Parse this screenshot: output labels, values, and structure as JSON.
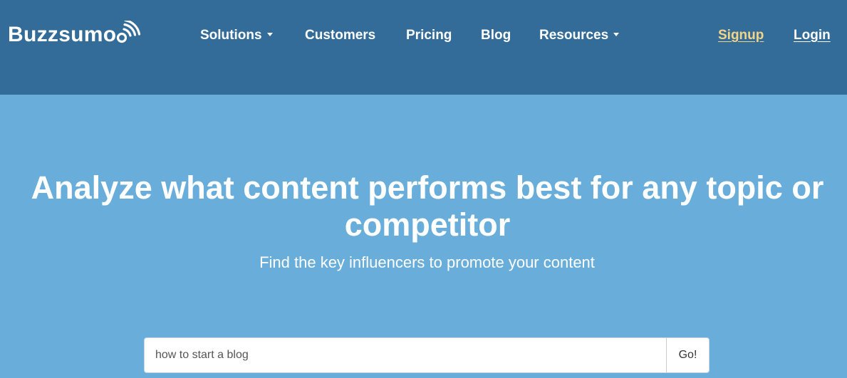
{
  "brand": {
    "name": "Buzzsumo"
  },
  "nav": {
    "solutions": "Solutions",
    "customers": "Customers",
    "pricing": "Pricing",
    "blog": "Blog",
    "resources": "Resources",
    "signup": "Signup",
    "login": "Login"
  },
  "hero": {
    "title": "Analyze what content performs best for any topic or competitor",
    "subtitle": "Find the key influencers to promote your content"
  },
  "search": {
    "value": "how to start a blog",
    "button_label": "Go!"
  },
  "colors": {
    "navbar": "#336c98",
    "hero": "#69aedb",
    "signup": "#f3d385"
  },
  "icons": {
    "logo": "signal-waves-icon",
    "dropdown": "caret-down-icon"
  }
}
